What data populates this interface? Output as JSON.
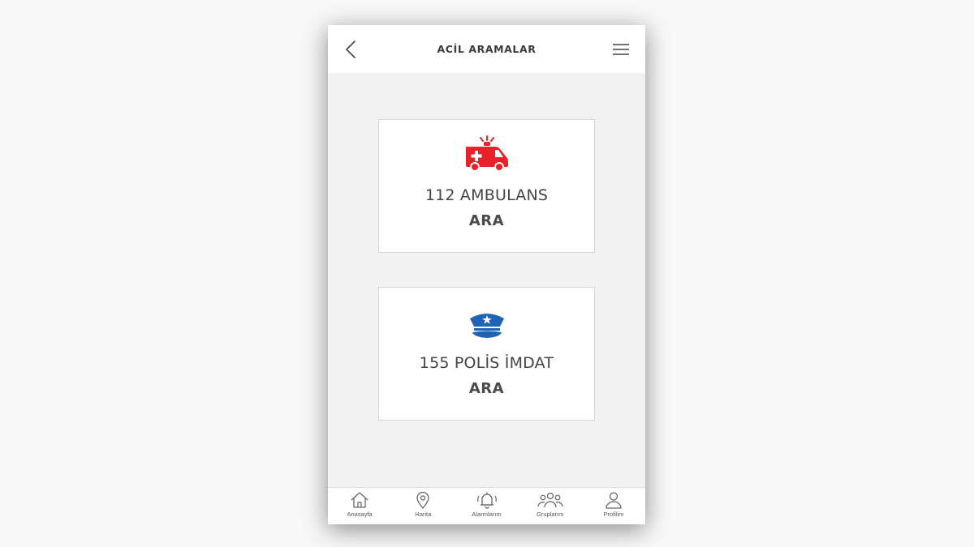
{
  "header": {
    "title": "ACİL ARAMALAR",
    "back_icon": "chevron-left-icon",
    "menu_icon": "hamburger-menu-icon"
  },
  "cards": [
    {
      "icon": "ambulance-icon",
      "label": "112 AMBULANS",
      "action": "ARA",
      "color": "#e8212b"
    },
    {
      "icon": "police-cap-icon",
      "label": "155 POLİS İMDAT",
      "action": "ARA",
      "color": "#1f63b5"
    }
  ],
  "tabbar": {
    "items": [
      {
        "label": "Anasayfa",
        "icon": "home-icon"
      },
      {
        "label": "Harita",
        "icon": "map-pin-icon"
      },
      {
        "label": "Alarmlarım",
        "icon": "alarm-bell-icon"
      },
      {
        "label": "Gruplarım",
        "icon": "group-icon"
      },
      {
        "label": "Profilim",
        "icon": "user-icon"
      }
    ]
  },
  "colors": {
    "background": "#f2f2f3",
    "text": "#444444",
    "icon_gray": "#666666"
  }
}
